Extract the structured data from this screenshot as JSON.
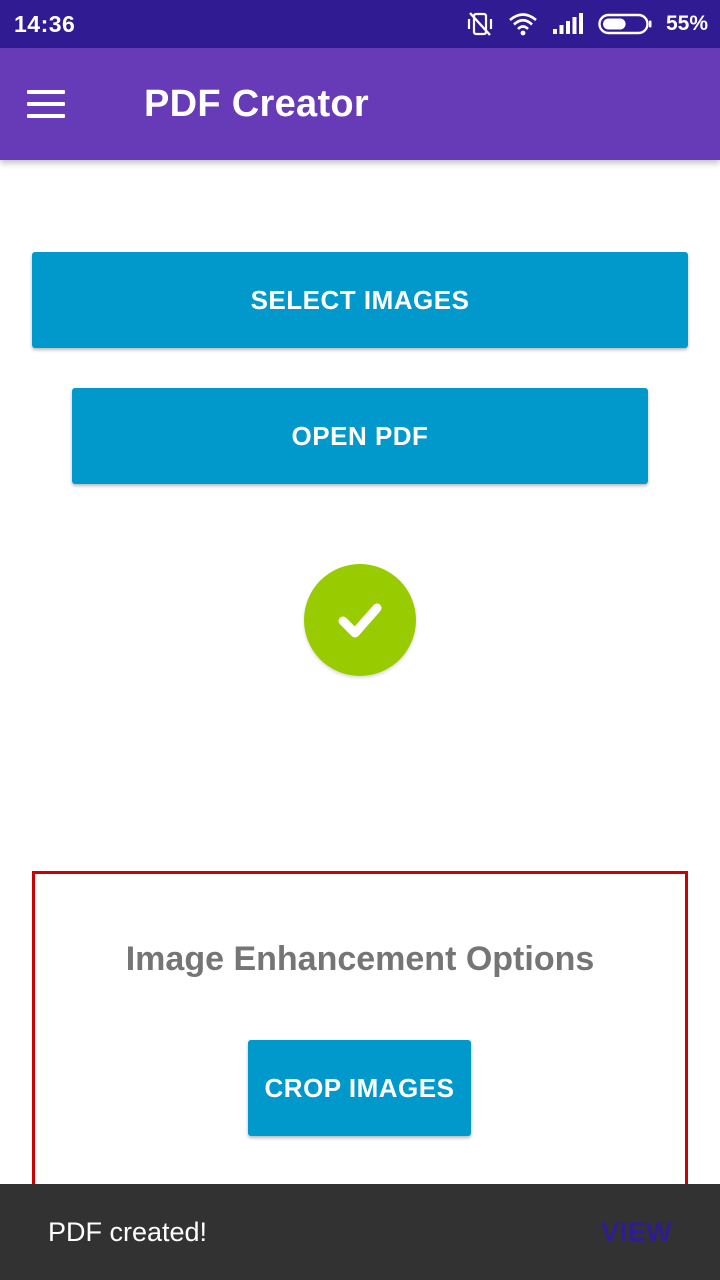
{
  "status_bar": {
    "time": "14:36",
    "battery_percent": "55%",
    "battery_level": 0.55,
    "icons": [
      "vibrate-off-icon",
      "wifi-icon",
      "signal-icon",
      "battery-icon"
    ]
  },
  "app_bar": {
    "title": "PDF Creator",
    "menu_icon": "hamburger-menu-icon",
    "background": "#673ab7"
  },
  "main": {
    "select_images_label": "SELECT IMAGES",
    "open_pdf_label": "OPEN PDF",
    "success_icon": "check-circle-icon",
    "button_color": "#0199cc",
    "success_color": "#99cc00"
  },
  "enhancement": {
    "title": "Image Enhancement Options",
    "crop_images_label": "CROP IMAGES",
    "border_color": "#cc0000"
  },
  "snackbar": {
    "message": "PDF created!",
    "action_label": "VIEW"
  }
}
